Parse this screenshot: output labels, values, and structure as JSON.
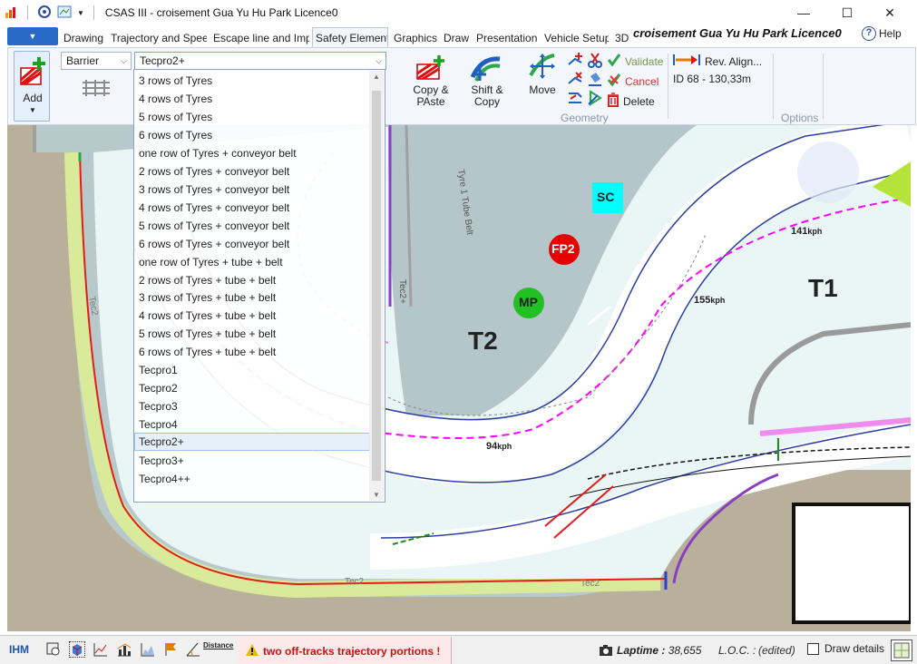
{
  "window": {
    "title": "CSAS III - croisement Gua Yu Hu Park Licence0",
    "minimize": "—",
    "maximize": "☐",
    "close": "✕"
  },
  "ribbon_tabs": [
    {
      "label": "Drawing"
    },
    {
      "label": "Trajectory and Spee"
    },
    {
      "label": "Escape line and Imp"
    },
    {
      "label": "Safety Element",
      "active": true
    },
    {
      "label": "Graphics"
    },
    {
      "label": "Draw"
    },
    {
      "label": "Presentation"
    },
    {
      "label": "Vehicle Setup"
    },
    {
      "label": "3D"
    }
  ],
  "ribbon_title": "croisement Gua Yu Hu Park Licence0",
  "help_label": "Help",
  "ribbon": {
    "add_label": "Add",
    "type_combo": "Barrier",
    "model_combo": "Tecpro2+",
    "copy_paste": [
      "Copy &",
      "PAste"
    ],
    "shift_copy": [
      "Shift &",
      "Copy"
    ],
    "move": "Move",
    "validate": "Validate",
    "cancel": "Cancel",
    "delete": "Delete",
    "rev_align": "Rev. Align...",
    "id_label": "ID  68 - 130,33m",
    "geometry_group": "Geometry",
    "options_group": "Options"
  },
  "dropdown_items": [
    "3 rows of Tyres",
    "4 rows of Tyres",
    "5 rows of Tyres",
    "6 rows of Tyres",
    "one row of Tyres + conveyor belt",
    "2 rows of Tyres + conveyor belt",
    "3 rows of Tyres + conveyor belt",
    "4 rows of Tyres + conveyor belt",
    "5 rows of Tyres + conveyor belt",
    "6 rows of Tyres + conveyor belt",
    "one row of Tyres + tube + belt",
    "2 rows of Tyres + tube + belt",
    "3 rows of Tyres + tube + belt",
    "4 rows of Tyres + tube + belt",
    "5 rows of Tyres + tube + belt",
    "6 rows of Tyres + tube + belt",
    "Tecpro1",
    "Tecpro2",
    "Tecpro3",
    "Tecpro4",
    "Tecpro2+",
    "Tecpro3+",
    "Tecpro4++"
  ],
  "dropdown_selected": "Tecpro2+",
  "map": {
    "corners": {
      "t1": "T1",
      "t2": "T2"
    },
    "markers": {
      "sc": "SC",
      "fp2": "FP2",
      "mp": "MP"
    },
    "speeds": {
      "s141": "141",
      "s155": "155",
      "s94": "94",
      "unit": "kph"
    },
    "barrier_labels": {
      "tyre_tube_belt": "Tyre 1 Tube Belt",
      "tec_top": "Tec2+",
      "tec_left": "Tec2",
      "tec_bottom1": "Tec2",
      "tec_bottom2": "Tec2"
    },
    "colors": {
      "track": "#ffffff",
      "runoff": "#eaf5f6",
      "grass": "#b6d5ae",
      "gravel": "#b9b09b",
      "tecpro": "#8a3fc0",
      "trajectory": "#ff00ff",
      "kerb": "#d9ea9a",
      "barrier_red": "#e21b1b"
    }
  },
  "status": {
    "ihm": "IHM",
    "distance": "Distance",
    "warning": "two off-tracks trajectory portions !",
    "laptime_label": "Laptime :",
    "laptime_value": "38,655",
    "loc": "L.O.C. :",
    "edited": "(edited)",
    "draw_details": "Draw details"
  }
}
